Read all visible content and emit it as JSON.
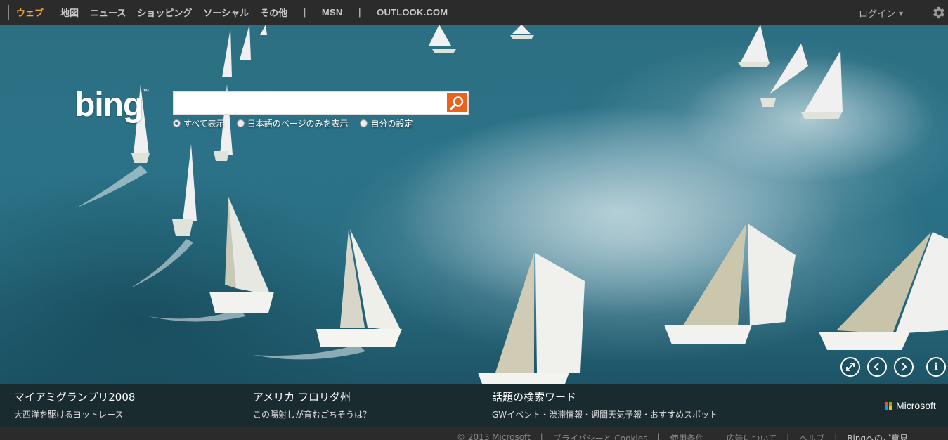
{
  "topbar": {
    "nav": [
      "ウェブ",
      "地図",
      "ニュース",
      "ショッピング",
      "ソーシャル",
      "その他"
    ],
    "separator": "|",
    "links": [
      "MSN",
      "OUTLOOK.COM"
    ],
    "login": "ログイン",
    "accent_color": "#f4a83a"
  },
  "logo": {
    "text": "bing",
    "trademark": "™"
  },
  "search": {
    "value": "",
    "placeholder": "",
    "button_color": "#e9621e",
    "filters": [
      "すべて表示",
      "日本語のページのみを表示",
      "自分の設定"
    ],
    "selected_filter": "すべて表示"
  },
  "image_controls": {
    "icons": [
      "fullscreen-icon",
      "previous-icon",
      "next-icon",
      "info-icon"
    ],
    "info_glyph": "i"
  },
  "hotspots": [
    {
      "title": "マイアミグランプリ2008",
      "subtitle": "大西洋を駆けるヨットレース"
    },
    {
      "title": "アメリカ フロリダ州",
      "subtitle": "この陽射しが育むごちそうは？"
    },
    {
      "title": "話題の検索ワード",
      "subtitle": "GWイベント・渋滞情報・週間天気予報・おすすめスポット"
    }
  ],
  "branding": {
    "microsoft": "Microsoft",
    "colors": [
      "#f25022",
      "#7fba00",
      "#00a4ef",
      "#ffb900"
    ]
  },
  "footer": {
    "items": [
      "© 2013 Microsoft",
      "プライバシーと Cookies",
      "使用条件",
      "広告について",
      "ヘルプ"
    ],
    "separator": "|",
    "feedback": "Bingへのご意見"
  }
}
